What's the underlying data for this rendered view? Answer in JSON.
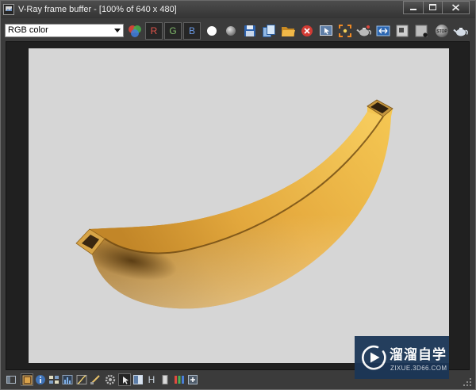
{
  "window": {
    "title": "V-Ray frame buffer - [100% of 640 x 480]",
    "controls": [
      "minimize-icon",
      "maximize-icon",
      "close-icon"
    ]
  },
  "toolbar": {
    "channel_select": {
      "value": "RGB color"
    },
    "channel_buttons": {
      "red": "R",
      "green": "G",
      "blue": "B"
    },
    "stop_label": "STOP",
    "icons": [
      "rgb-channels-icon",
      "alpha-channel-icon",
      "monochrome-icon",
      "save-icon",
      "duplicate-icon",
      "open-folder-icon",
      "clear-image-icon",
      "track-mouse-icon",
      "region-render-icon",
      "render-last-icon",
      "corrections-icon",
      "pixel-info-icon",
      "color-clamp-icon",
      "stop-render-icon",
      "render-teapot-icon"
    ]
  },
  "status_bar": {
    "histogram_label": "H",
    "icons": [
      "toggle-panel-icon",
      "history-icon",
      "info-icon",
      "grid-icon",
      "levels-icon",
      "curves-icon",
      "lens-effects-icon",
      "settings-gear-icon",
      "pointer-icon",
      "compare-icon",
      "histogram-icon",
      "split-bar-icon",
      "color-bars-icon",
      "add-icon",
      "resize-grip-icon"
    ]
  },
  "watermark": {
    "title": "溜溜自学",
    "subtitle": "ZIXUE.3D66.COM"
  },
  "colors": {
    "red_channel": "#e0544a",
    "green_channel": "#7fb86a",
    "blue_channel": "#6b9be6",
    "watermark_background": "#1b3657",
    "render_background": "#d6d6d6"
  }
}
